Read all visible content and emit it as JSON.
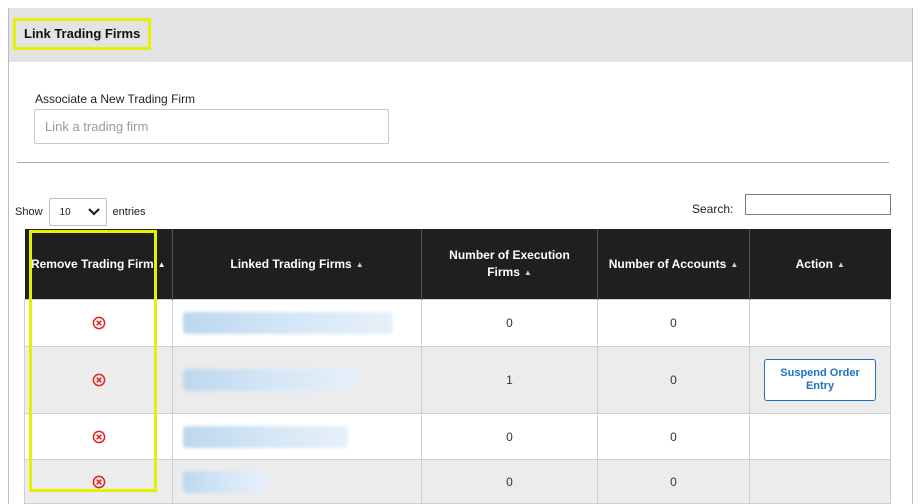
{
  "section": {
    "title": "Link Trading Firms"
  },
  "associate": {
    "label": "Associate a New Trading Firm",
    "placeholder": "Link a trading firm"
  },
  "length": {
    "show": "Show",
    "value": "10",
    "entries": "entries"
  },
  "search": {
    "label": "Search:"
  },
  "table": {
    "headers": {
      "remove": "Remove Trading Firm",
      "linked": "Linked Trading Firms",
      "execution": "Number of Execution Firms",
      "accounts": "Number of Accounts",
      "action": "Action"
    },
    "rows": [
      {
        "execution_firms": "0",
        "accounts": "0",
        "action": ""
      },
      {
        "execution_firms": "1",
        "accounts": "0",
        "action": "Suspend Order Entry"
      },
      {
        "execution_firms": "0",
        "accounts": "0",
        "action": ""
      },
      {
        "execution_firms": "0",
        "accounts": "0",
        "action": ""
      }
    ]
  },
  "colors": {
    "highlight": "#e6f000",
    "header_bg": "#1f1f1f",
    "remove_icon": "#e02424",
    "action_accent": "#1a73c9"
  },
  "icons": {
    "remove": "remove-circle-x-icon",
    "dropdown": "chevron-down-icon",
    "sort": "sort-up-icon"
  }
}
